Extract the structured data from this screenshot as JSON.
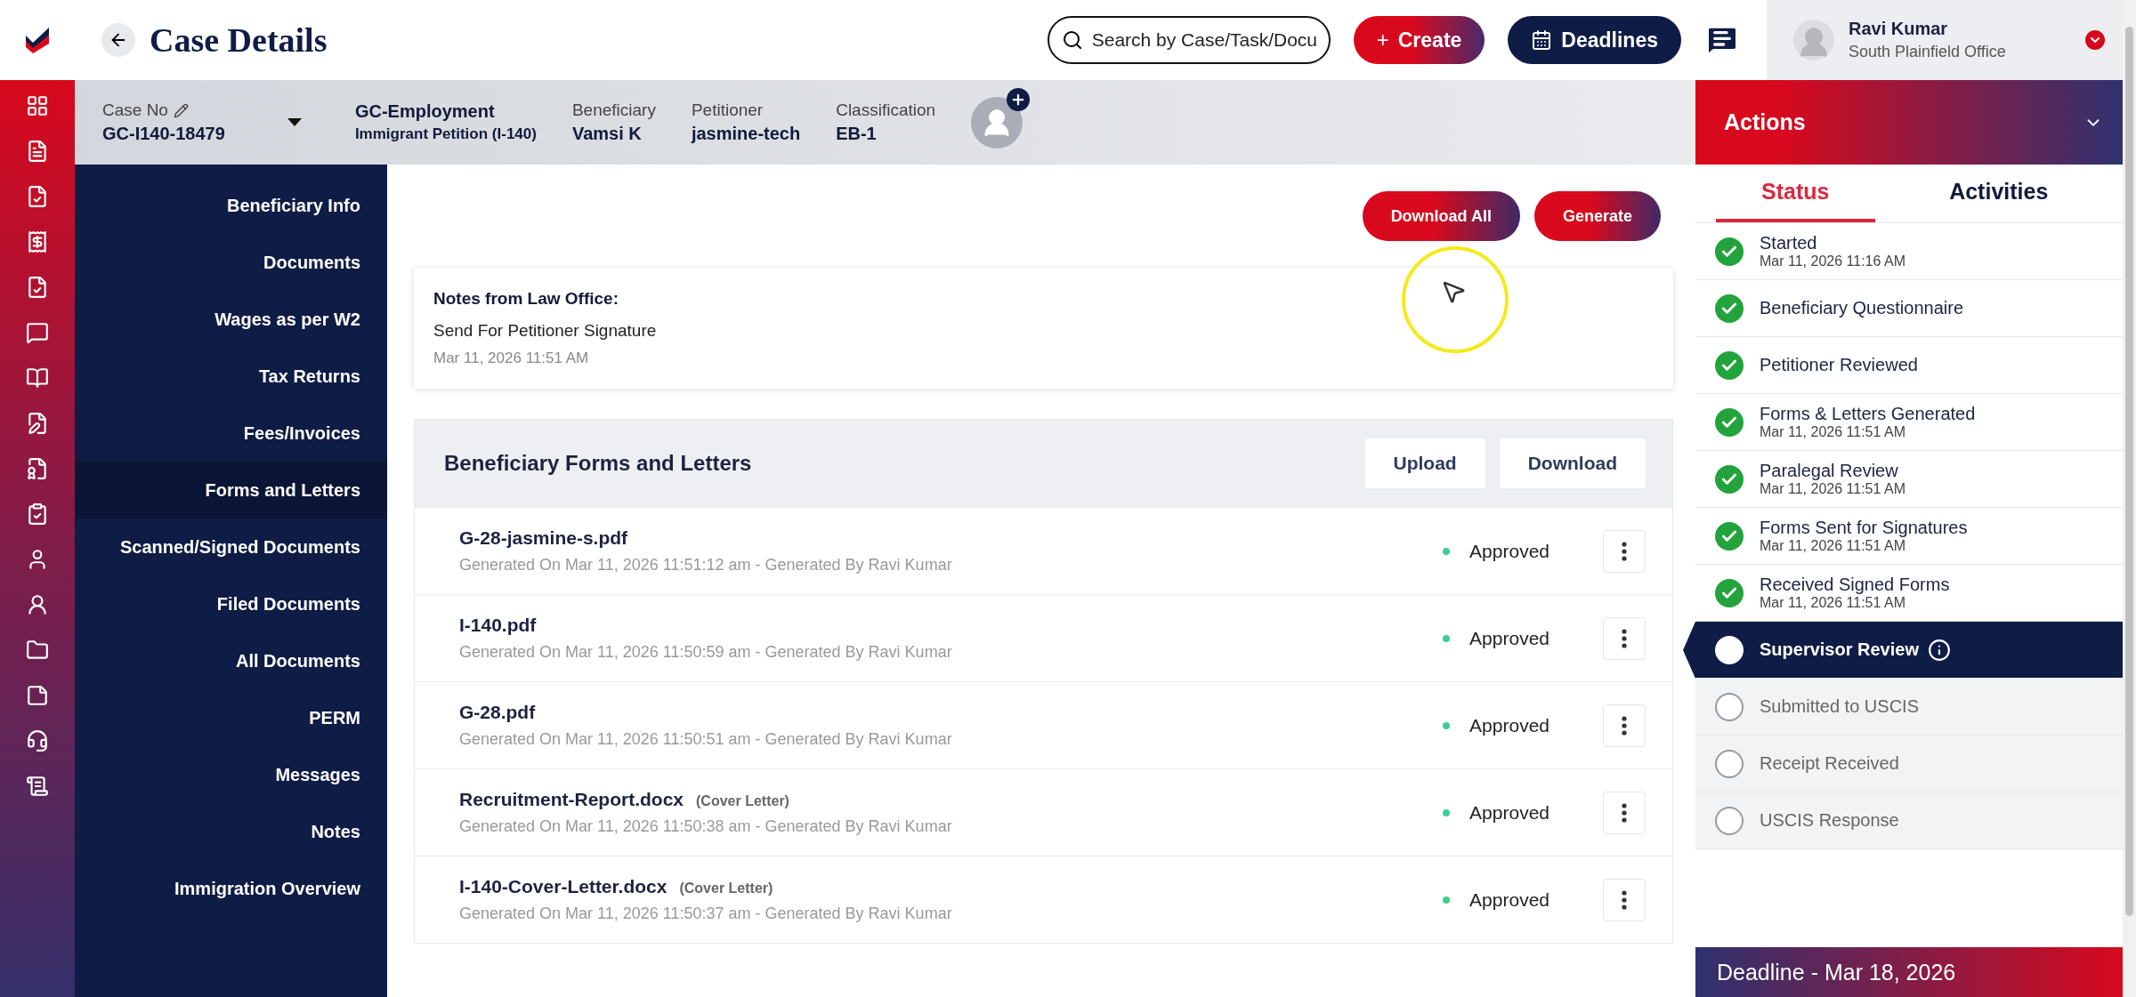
{
  "header": {
    "title": "Case Details",
    "search": {
      "placeholder": "Search by Case/Task/Docu"
    },
    "create_label": "+",
    "create": "Create",
    "deadlines": "Deadlines",
    "user": {
      "name": "Ravi Kumar",
      "office": "South Plainfield Office"
    }
  },
  "case_bar": {
    "case_no_label": "Case No",
    "case_no": "GC-I140-18479",
    "case_type": "GC-Employment",
    "case_subtype": "Immigrant Petition (I-140)",
    "fields": [
      {
        "label": "Beneficiary",
        "value": "Vamsi K"
      },
      {
        "label": "Petitioner",
        "value": "jasmine-tech"
      },
      {
        "label": "Classification",
        "value": "EB-1"
      }
    ]
  },
  "nav": [
    {
      "label": "Beneficiary Info",
      "selected": false
    },
    {
      "label": "Documents",
      "selected": false
    },
    {
      "label": "Wages as per W2",
      "selected": false
    },
    {
      "label": "Tax Returns",
      "selected": false
    },
    {
      "label": "Fees/Invoices",
      "selected": false
    },
    {
      "label": "Forms and Letters",
      "selected": true
    },
    {
      "label": "Scanned/Signed Documents",
      "selected": false
    },
    {
      "label": "Filed Documents",
      "selected": false
    },
    {
      "label": "All Documents",
      "selected": false
    },
    {
      "label": "PERM",
      "selected": false
    },
    {
      "label": "Messages",
      "selected": false
    },
    {
      "label": "Notes",
      "selected": false
    },
    {
      "label": "Immigration Overview",
      "selected": false
    }
  ],
  "top_buttons": [
    "Download All",
    "Generate"
  ],
  "notes": {
    "heading": "Notes from Law Office:",
    "text": "Send For Petitioner Signature",
    "date": "Mar 11, 2026 11:51 AM"
  },
  "forms": {
    "title": "Beneficiary Forms and Letters",
    "buttons": [
      "Upload",
      "Download"
    ],
    "rows": [
      {
        "name": "G-28-jasmine-s.pdf",
        "meta": "Generated On Mar 11, 2026 11:51:12 am - Generated By Ravi Kumar",
        "status": "Approved",
        "color": "#3ecf8e"
      },
      {
        "name": "I-140.pdf",
        "meta": "Generated On Mar 11, 2026 11:50:59 am - Generated By Ravi Kumar",
        "status": "Approved",
        "color": "#3ecf8e"
      },
      {
        "name": "G-28.pdf",
        "meta": "Generated On Mar 11, 2026 11:50:51 am - Generated By Ravi Kumar",
        "status": "Approved",
        "color": "#3ecf8e"
      },
      {
        "name": "Recruitment-Report.docx",
        "tag": "(Cover Letter)",
        "meta": "Generated On Mar 11, 2026 11:50:38 am - Generated By Ravi Kumar",
        "status": "Approved",
        "color": "#3ecf8e"
      },
      {
        "name": "I-140-Cover-Letter.docx",
        "tag": "(Cover Letter)",
        "meta": "Generated On Mar 11, 2026 11:50:37 am - Generated By Ravi Kumar",
        "status": "Approved",
        "color": "#3ecf8e"
      }
    ]
  },
  "actions": {
    "title": "Actions",
    "tabs": [
      {
        "label": "Status",
        "selected": true
      },
      {
        "label": "Activities",
        "selected": false
      }
    ],
    "steps": [
      {
        "label": "Started",
        "date": "Mar 11, 2026 11:16 AM",
        "kind": "done"
      },
      {
        "label": "Beneficiary Questionnaire",
        "kind": "done"
      },
      {
        "label": "Petitioner Reviewed",
        "kind": "done"
      },
      {
        "label": "Forms & Letters Generated",
        "date": "Mar 11, 2026 11:51 AM",
        "kind": "done"
      },
      {
        "label": "Paralegal Review",
        "date": "Mar 11, 2026 11:51 AM",
        "kind": "done"
      },
      {
        "label": "Forms Sent for Signatures",
        "date": "Mar 11, 2026 11:51 AM",
        "kind": "done"
      },
      {
        "label": "Received Signed Forms",
        "date": "Mar 11, 2026 11:51 AM",
        "kind": "done"
      },
      {
        "label": "Supervisor Review",
        "kind": "current"
      },
      {
        "label": "Submitted to USCIS",
        "kind": "pending"
      },
      {
        "label": "Receipt Received",
        "kind": "pending"
      },
      {
        "label": "USCIS Response",
        "kind": "pending"
      }
    ],
    "deadline": "Deadline - Mar 18, 2026"
  }
}
